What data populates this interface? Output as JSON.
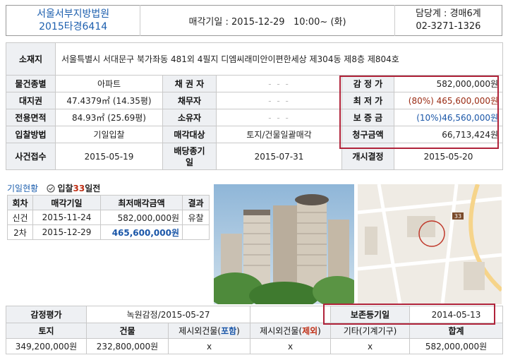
{
  "header": {
    "court_name": "서울서부지방법원",
    "case_no": "2015타경6414",
    "auction_date_label": "매각기일",
    "auction_date": "2015-12-29",
    "auction_time": "10:00~ (화)",
    "officer_label": "담당계",
    "officer": "경매6계",
    "phone": "02-3271-1326"
  },
  "property": {
    "location_label": "소재지",
    "location": "서울특별시 서대문구 북가좌동 481외 4필지 디엠씨래미안이편한세상 제304동 제8층 제804호",
    "type_label": "물건종별",
    "type": "아파트",
    "creditor_label": "채 권 자",
    "land_label": "대지권",
    "land": "47.4379㎡ (14.35평)",
    "debtor_label": "채무자",
    "area_label": "전용면적",
    "area": "84.93㎡ (25.69평)",
    "owner_label": "소유자",
    "bid_method_label": "입찰방법",
    "bid_method": "기일입찰",
    "sale_target_label": "매각대상",
    "sale_target": "토지/건물일괄매각",
    "case_received_label": "사건접수",
    "case_received": "2015-05-19",
    "dividend_deadline_label": "배당종기일",
    "dividend_deadline": "2015-07-31",
    "commence_label": "개시결정",
    "commence": "2015-05-20",
    "masked": "- - -"
  },
  "prices": {
    "appraisal_label": "감 정 가",
    "appraisal": "582,000,000원",
    "min_price_label": "최 저 가",
    "min_price": "(80%) 465,600,000원",
    "deposit_label": "보 증 금",
    "deposit": "(10%)46,560,000원",
    "claim_label": "청구금액",
    "claim": "66,713,424원"
  },
  "history": {
    "title": "기일현황",
    "dday_prefix": "입찰",
    "dday_num": "33",
    "dday_suffix": "일전",
    "headers": [
      "회차",
      "매각기일",
      "최저매각금액",
      "결과"
    ],
    "rows": [
      {
        "round": "신건",
        "date": "2015-11-24",
        "price": "582,000,000원",
        "result": "유찰"
      },
      {
        "round": "2차",
        "date": "2015-12-29",
        "price": "465,600,000원",
        "result": ""
      }
    ]
  },
  "map": {
    "badge": "33"
  },
  "appraisal_detail": {
    "label": "감정평가",
    "value": "녹원감정/2015-05-27",
    "preserve_label": "보존등기일",
    "preserve_date": "2014-05-13",
    "headers": {
      "land": "토지",
      "building": "건물",
      "excl_in_a": "제시외건물(",
      "excl_in_b": "포함",
      "excl_out_a": "제시외건물(",
      "excl_out_b": "제외",
      "etc_a": "기타(",
      "etc_b": "기계기구",
      "close": ")",
      "total": "합계"
    },
    "values": {
      "land": "349,200,000원",
      "building": "232,800,000원",
      "excl_in": "x",
      "excl_out": "x",
      "etc": "x",
      "total": "582,000,000원"
    }
  },
  "colors": {
    "accent_red": "#b0233a",
    "court_blue": "#1d5fae",
    "price_brown": "#9a2b13"
  }
}
